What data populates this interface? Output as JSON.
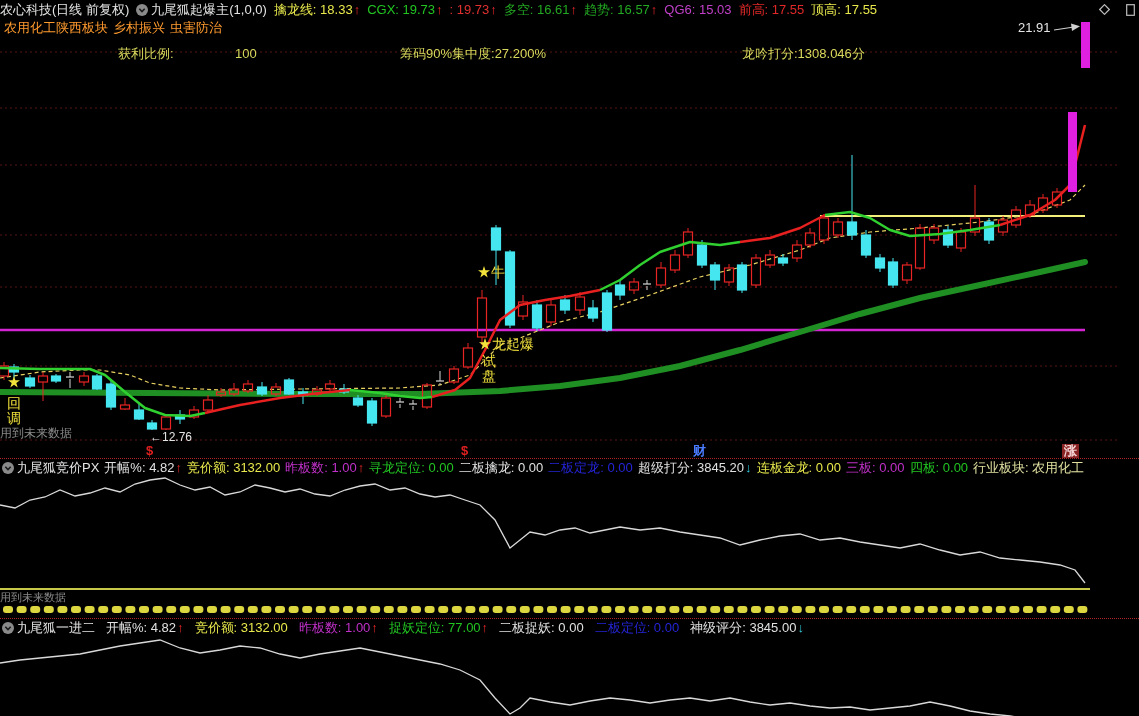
{
  "title_bar": {
    "stock": "农心科技(日线 前复权)",
    "indicator": "九尾狐起爆主(1,0,0)",
    "values": [
      {
        "text": "擒龙线: 18.33",
        "color": "#e8e84c",
        "arrow": {
          "text": "↑",
          "kind": "up"
        }
      },
      {
        "text": "CGX: 19.73",
        "color": "#22c422",
        "arrow": {
          "text": "↑",
          "kind": "up"
        }
      },
      {
        "text": ": 19.73",
        "color": "#e03030",
        "arrow": {
          "text": "↑",
          "kind": "up"
        }
      },
      {
        "text": "多空: 16.61",
        "color": "#22a822",
        "arrow": {
          "text": "↑",
          "kind": "up"
        }
      },
      {
        "text": "趋势: 16.57",
        "color": "#22a822",
        "arrow": {
          "text": "↑",
          "kind": "up"
        }
      },
      {
        "text": "QG6: 15.03",
        "color": "#c040c8"
      },
      {
        "text": "前高: 17.55",
        "color": "#e02828"
      },
      {
        "text": "顶高: 17.55",
        "color": "#e8e84c"
      }
    ]
  },
  "sectors": [
    "农用化工陕西板块",
    "乡村振兴",
    "虫害防治"
  ],
  "stats": [
    "获利比例:",
    "100",
    "筹码90%集中度:27.200%",
    "龙吟打分:1308.046分"
  ],
  "main_chart": {
    "high_label": "21.91",
    "low_label": "←12.76",
    "notice": "用到未来数据",
    "signals": [
      {
        "text": "回调",
        "star": true,
        "kind": "vertical"
      },
      {
        "text": "牛",
        "star": true,
        "kind": "horizontal"
      },
      {
        "text": "龙起爆",
        "star": true,
        "kind": "horizontal"
      },
      {
        "text": "试盘",
        "star": false,
        "kind": "vertical"
      }
    ],
    "markers": [
      {
        "text": "$",
        "color": "#e02020",
        "kind": "plain"
      },
      {
        "text": "$",
        "color": "#e02020",
        "kind": "plain"
      },
      {
        "text": "财",
        "color": "#4a7cff",
        "kind": "plain"
      },
      {
        "text": "涨",
        "color": "#8a2424",
        "kind": "tag"
      }
    ]
  },
  "panels": [
    {
      "title": "九尾狐竞价PX",
      "notice": "用到未来数据",
      "values": [
        {
          "text": "开幅%: 4.82",
          "color": "#e0e0e0",
          "arrow": {
            "text": "↑",
            "kind": "up"
          }
        },
        {
          "text": "竞价额: 3132.00",
          "color": "#e8e84c"
        },
        {
          "text": "昨板数: 1.00",
          "color": "#c030c8",
          "arrow": {
            "text": "↑",
            "kind": "up"
          }
        },
        {
          "text": "寻龙定位: 0.00",
          "color": "#22c422"
        },
        {
          "text": "二板擒龙: 0.00",
          "color": "#e0e0e0"
        },
        {
          "text": "二板定龙: 0.00",
          "color": "#2424d8"
        },
        {
          "text": "超级打分: 3845.20",
          "color": "#e0e0e0",
          "arrow": {
            "text": "↓",
            "kind": "down"
          }
        },
        {
          "text": "连板金龙: 0.00",
          "color": "#e8e84c"
        },
        {
          "text": "三板: 0.00",
          "color": "#c030c8"
        },
        {
          "text": "四板: 0.00",
          "color": "#22c422"
        },
        {
          "text": "行业板块: 农用化工",
          "color": "#e0e0a0"
        }
      ]
    },
    {
      "title": "九尾狐一进二",
      "values": [
        {
          "text": "开幅%: 4.82",
          "color": "#e0e0e0",
          "arrow": {
            "text": "↑",
            "kind": "up"
          }
        },
        {
          "text": "竞价额: 3132.00",
          "color": "#e8e84c"
        },
        {
          "text": "昨板数: 1.00",
          "color": "#c030c8",
          "arrow": {
            "text": "↑",
            "kind": "up"
          }
        },
        {
          "text": "捉妖定位: 77.00",
          "color": "#22c422",
          "arrow": {
            "text": "↑",
            "kind": "up"
          }
        },
        {
          "text": "二板捉妖: 0.00",
          "color": "#e0e0e0"
        },
        {
          "text": "二板定位: 0.00",
          "color": "#2424d8"
        },
        {
          "text": "神级评分: 3845.00",
          "color": "#e0e0e0",
          "arrow": {
            "text": "↓",
            "kind": "down"
          }
        }
      ]
    }
  ]
}
